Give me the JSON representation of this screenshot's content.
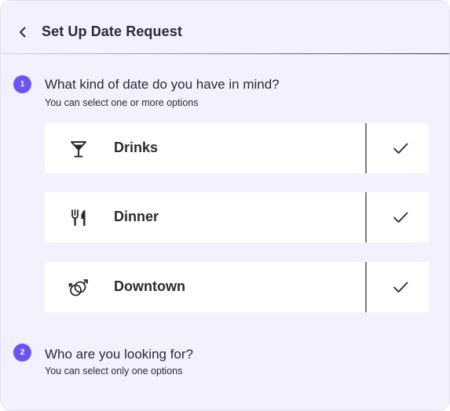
{
  "header": {
    "title": "Set Up Date Request",
    "back_icon": "chevron-left-icon"
  },
  "steps": [
    {
      "number": "1",
      "title": "What kind of date do you have in mind?",
      "subtitle": "You can select one or more options",
      "options": [
        {
          "label": "Drinks",
          "icon": "cocktail-icon",
          "selected": true
        },
        {
          "label": "Dinner",
          "icon": "fork-knife-icon",
          "selected": true
        },
        {
          "label": "Downtown",
          "icon": "gender-symbols-icon",
          "selected": true
        }
      ]
    },
    {
      "number": "2",
      "title": "Who are you looking for?",
      "subtitle": "You can select only one options"
    }
  ],
  "colors": {
    "background": "#f3f1fd",
    "accent": "#6b55f2",
    "text": "#2a2a33",
    "option_background": "#ffffff"
  }
}
